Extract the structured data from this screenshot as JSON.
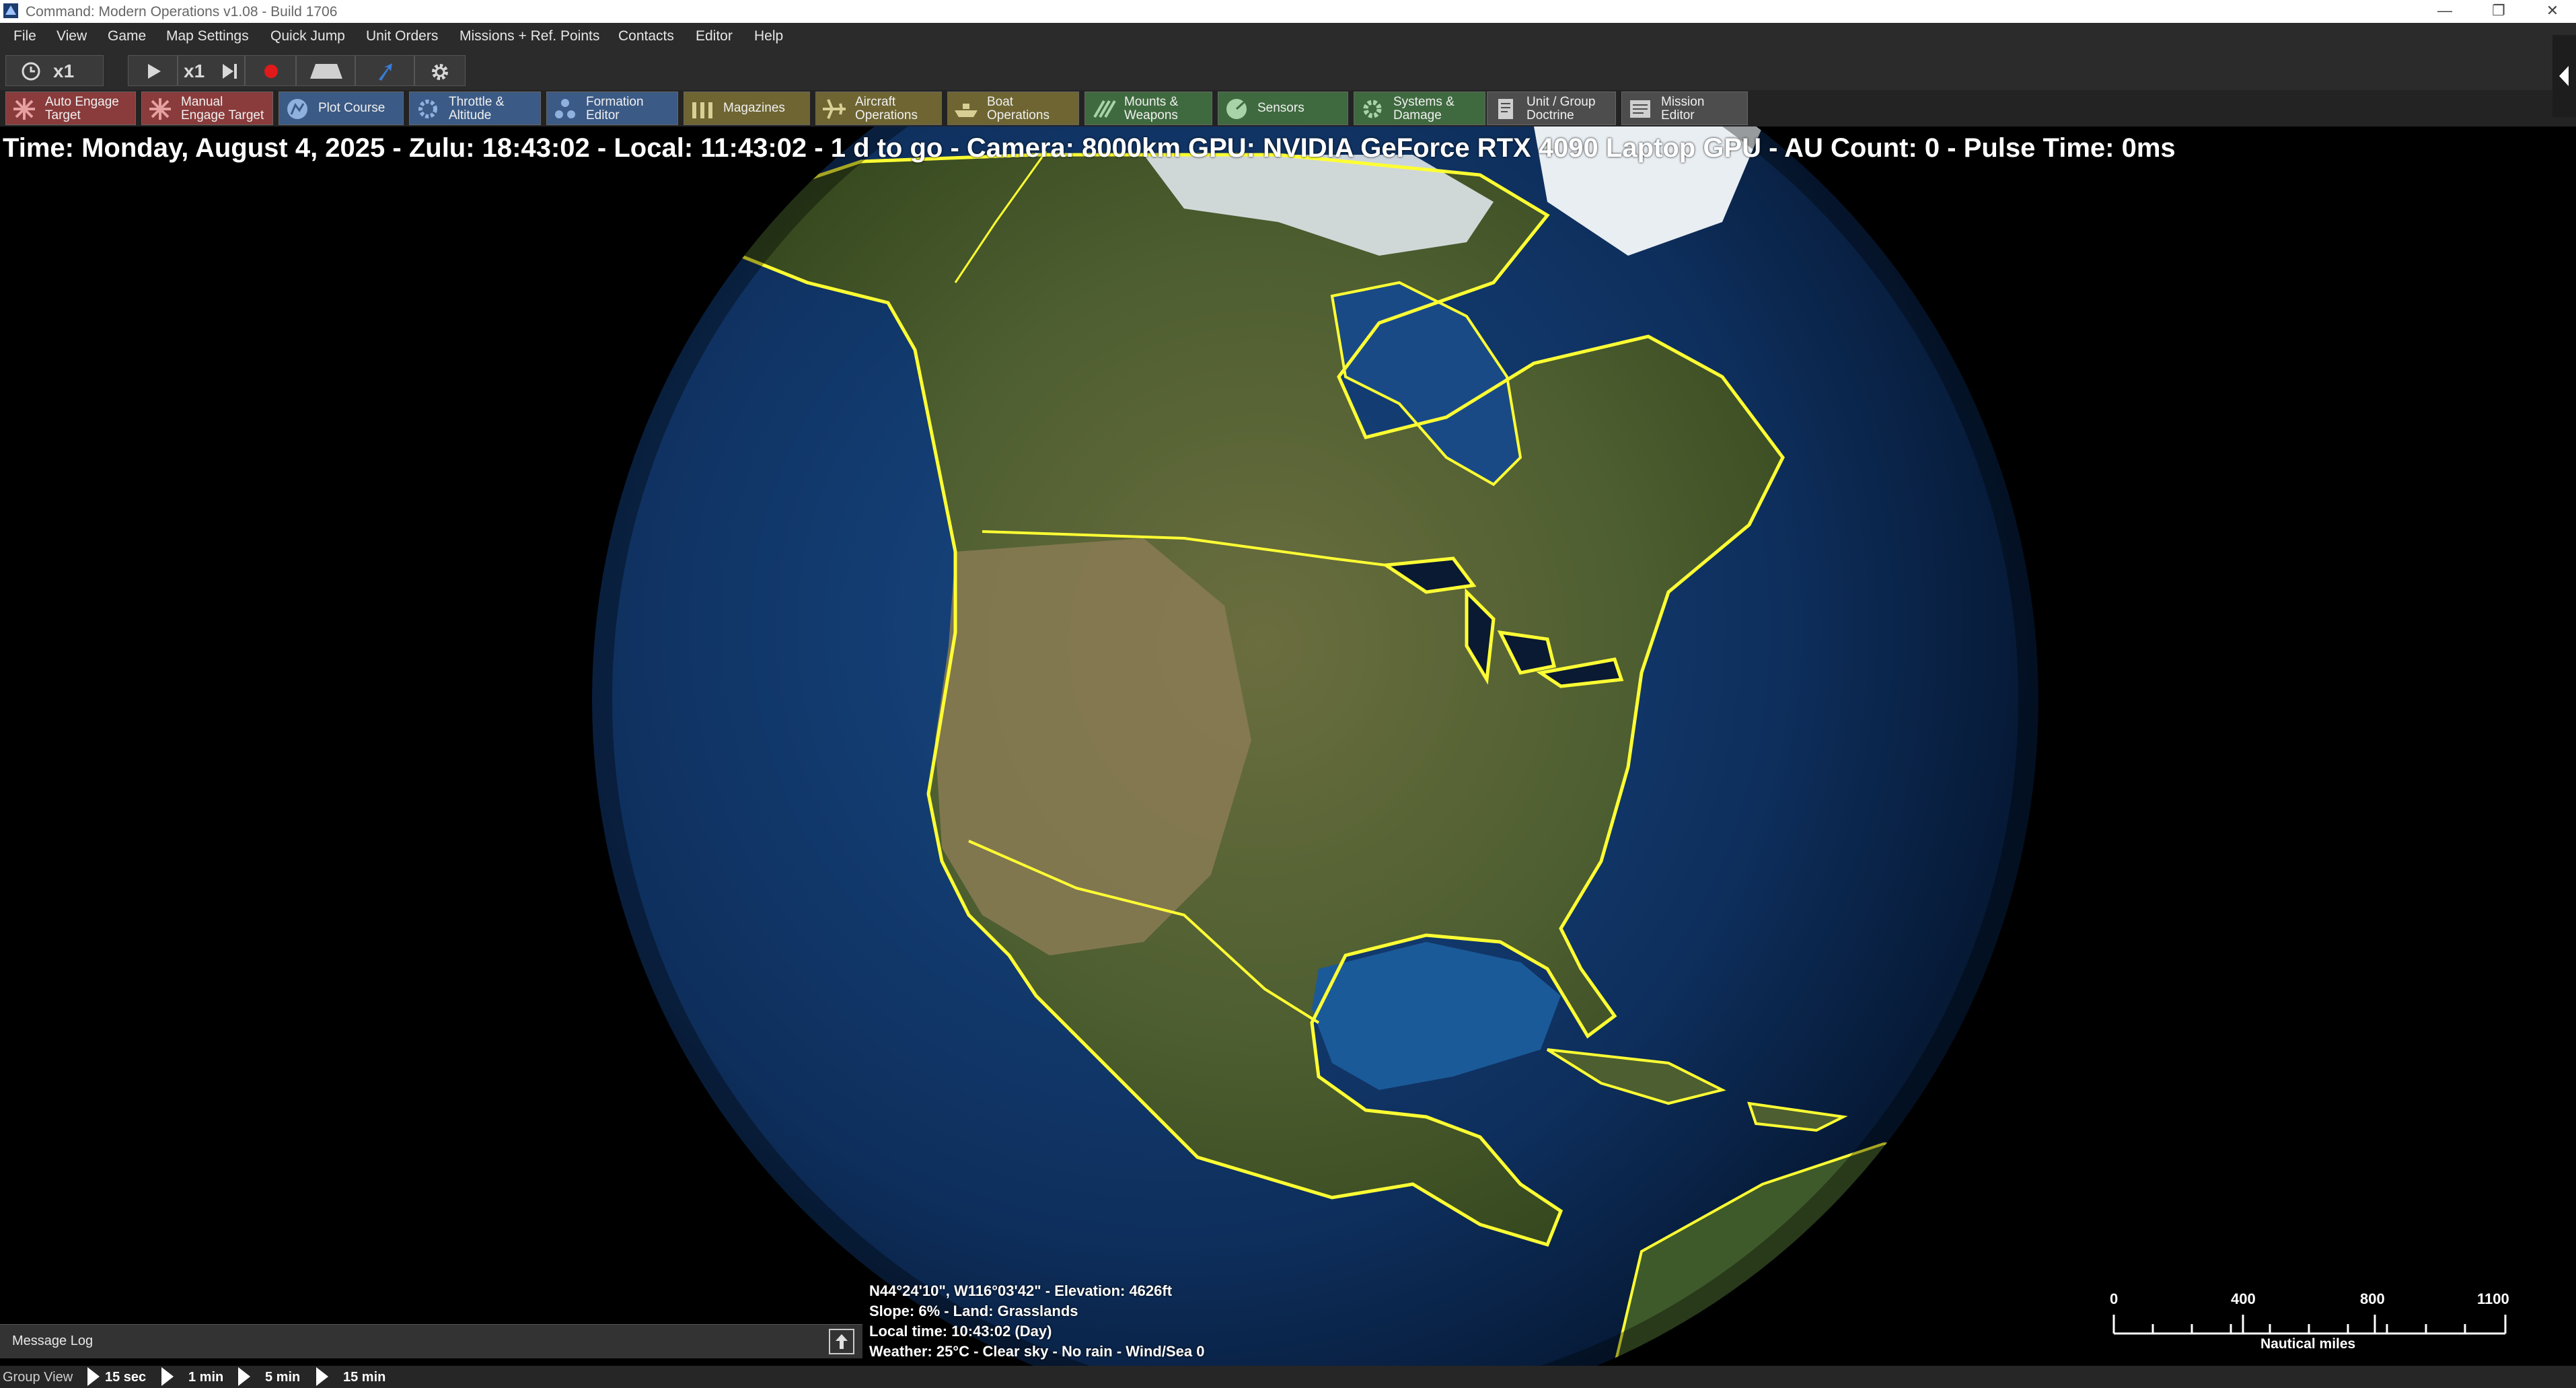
{
  "window": {
    "title": "Command: Modern Operations v1.08 - Build 1706",
    "controls": [
      "minimize-icon",
      "restore-icon",
      "close-icon"
    ]
  },
  "menu": [
    "File",
    "View",
    "Game",
    "Map Settings",
    "Quick Jump",
    "Unit Orders",
    "Missions + Ref. Points",
    "Contacts",
    "Editor",
    "Help"
  ],
  "toolbar1": {
    "time_compression": "x1",
    "step_compression": "x1",
    "icons": [
      "clock-icon",
      "play-icon",
      "step-icon",
      "record-icon",
      "camera-icon",
      "pointer-icon",
      "gear-icon"
    ]
  },
  "toolbar2": [
    {
      "label": "Auto Engage\nTarget",
      "icon": "auto-engage-icon"
    },
    {
      "label": "Manual\nEngage Target",
      "icon": "manual-engage-icon"
    },
    {
      "label": "Plot Course",
      "icon": "plot-course-icon"
    },
    {
      "label": "Throttle &\nAltitude",
      "icon": "throttle-icon"
    },
    {
      "label": "Formation\nEditor",
      "icon": "formation-icon"
    },
    {
      "label": "Magazines",
      "icon": "magazines-icon"
    },
    {
      "label": "Aircraft\nOperations",
      "icon": "aircraft-icon"
    },
    {
      "label": "Boat\nOperations",
      "icon": "boat-icon"
    },
    {
      "label": "Mounts &\nWeapons",
      "icon": "mounts-weapons-icon"
    },
    {
      "label": "Sensors",
      "icon": "sensors-icon"
    },
    {
      "label": "Systems &\nDamage",
      "icon": "systems-damage-icon"
    },
    {
      "label": "Unit / Group\nDoctrine",
      "icon": "doctrine-icon"
    },
    {
      "label": "Mission\nEditor",
      "icon": "mission-editor-icon"
    }
  ],
  "colors": {
    "engage_red": "#8a3b3b",
    "plot_blue": "#3b5a85",
    "magazine_olive": "#6e6532",
    "green": "#3f6a3f",
    "gray": "#4d4d4d",
    "border_yellow": "#ffff33",
    "ocean": "#0d2c5a"
  },
  "info_line": "Time: Monday, August 4, 2025 - Zulu: 18:43:02 - Local: 11:43:02 - 1 d to go - Camera: 8000km GPU: NVIDIA GeForce RTX 4090 Laptop GPU - AU Count: 0 - Pulse Time: 0ms",
  "cursor_info": {
    "line1": "N44°24'10\", W116°03'42\" - Elevation: 4626ft",
    "line2": "Slope: 6%  - Land: Grasslands",
    "line3": "Local time: 10:43:02 (Day)",
    "line4": "Weather: 25°C - Clear sky - No rain - Wind/Sea 0"
  },
  "message_log": {
    "label": "Message Log"
  },
  "scale": {
    "ticks": [
      "0",
      "400",
      "800",
      "1100"
    ],
    "unit": "Nautical miles"
  },
  "status": {
    "group_view": "Group View",
    "time_steps": [
      "15 sec",
      "1 min",
      "5 min",
      "15 min"
    ]
  }
}
